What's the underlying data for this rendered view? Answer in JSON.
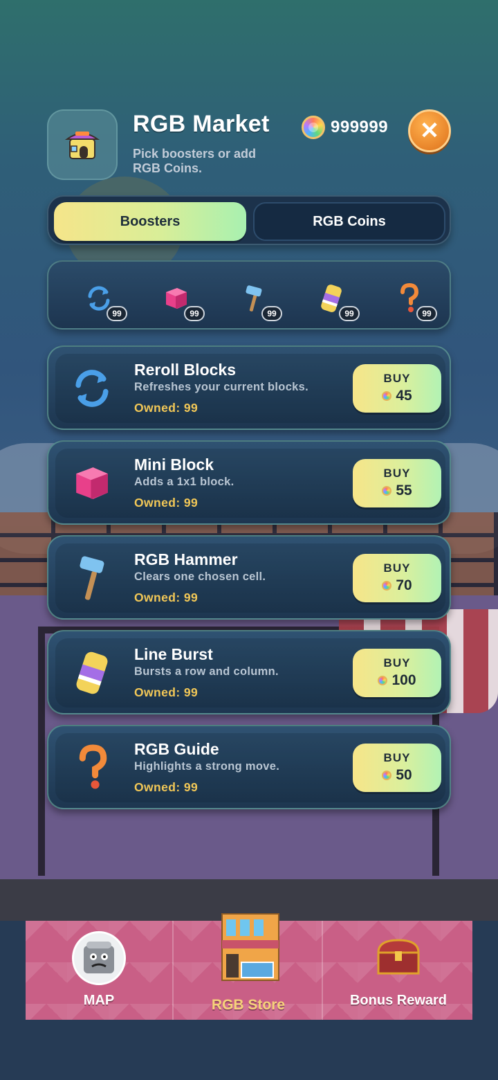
{
  "header": {
    "title": "RGB Market",
    "subtitle": "Pick boosters or add RGB Coins.",
    "coin_balance": "999999",
    "close_icon": "close-icon"
  },
  "tabs": [
    {
      "label": "Boosters",
      "active": true
    },
    {
      "label": "RGB Coins",
      "active": false
    }
  ],
  "inventory": [
    {
      "icon": "reroll-icon",
      "count": "99"
    },
    {
      "icon": "mini-block-icon",
      "count": "99"
    },
    {
      "icon": "hammer-icon",
      "count": "99"
    },
    {
      "icon": "line-burst-icon",
      "count": "99"
    },
    {
      "icon": "guide-icon",
      "count": "99"
    }
  ],
  "boosters": [
    {
      "name": "Reroll Blocks",
      "description": "Refreshes your current blocks.",
      "owned": "Owned: 99",
      "buy_label": "BUY",
      "price": "45",
      "icon": "reroll-icon"
    },
    {
      "name": "Mini Block",
      "description": "Adds a 1x1 block.",
      "owned": "Owned: 99",
      "buy_label": "BUY",
      "price": "55",
      "icon": "mini-block-icon"
    },
    {
      "name": "RGB Hammer",
      "description": "Clears one chosen cell.",
      "owned": "Owned: 99",
      "buy_label": "BUY",
      "price": "70",
      "icon": "hammer-icon"
    },
    {
      "name": "Line Burst",
      "description": "Bursts a row and column.",
      "owned": "Owned: 99",
      "buy_label": "BUY",
      "price": "100",
      "icon": "line-burst-icon"
    },
    {
      "name": "RGB Guide",
      "description": "Highlights a strong move.",
      "owned": "Owned: 99",
      "buy_label": "BUY",
      "price": "50",
      "icon": "guide-icon"
    }
  ],
  "bottom_nav": [
    {
      "label": "MAP",
      "icon": "map-avatar-icon",
      "active": false
    },
    {
      "label": "RGB Store",
      "icon": "store-building-icon",
      "active": true
    },
    {
      "label": "Bonus Reward",
      "icon": "treasure-chest-icon",
      "active": false
    }
  ],
  "colors": {
    "accent_yellow": "#f1c757",
    "button_gradient_start": "#f7e589",
    "button_gradient_end": "#b2f2b4",
    "close_orange": "#e8842a",
    "nav_pink": "#c95f86"
  }
}
